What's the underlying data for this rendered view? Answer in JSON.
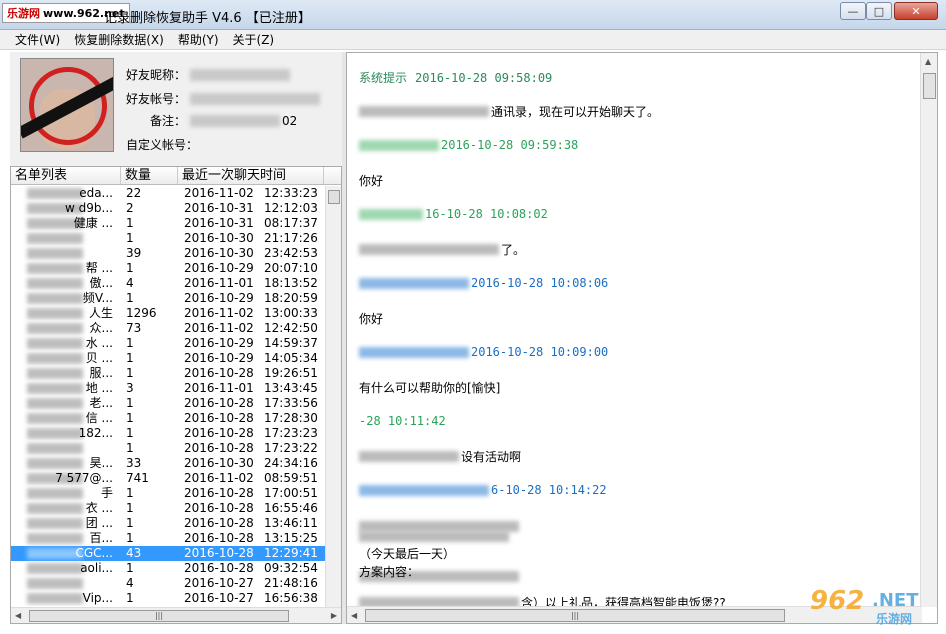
{
  "window": {
    "site_logo": "乐游网",
    "site_url": "www.962.net",
    "title": "记录删除恢复助手  V4.6 【已注册】",
    "minimize": "—",
    "maximize": "□",
    "close": "✕"
  },
  "menu": [
    {
      "label": "文件(W)"
    },
    {
      "label": "恢复删除数据(X)"
    },
    {
      "label": "帮助(Y)"
    },
    {
      "label": "关于(Z)"
    }
  ],
  "profile": {
    "nickname_label": "好友昵称：",
    "account_label": "好友帐号：",
    "remark_label": "备注：",
    "remark_value": "02",
    "custom_label": "自定义帐号："
  },
  "list": {
    "headers": {
      "name": "名单列表",
      "count": "数量",
      "last_time": "最近一次聊天时间"
    },
    "rows": [
      {
        "name": "eda...",
        "count": "22",
        "date": "2016-11-02",
        "time": "12:33:23"
      },
      {
        "name": "w d9b...",
        "count": "2",
        "date": "2016-10-31",
        "time": "12:12:03"
      },
      {
        "name": "健康 ...",
        "count": "1",
        "date": "2016-10-31",
        "time": "08:17:37"
      },
      {
        "name": "",
        "count": "1",
        "date": "2016-10-30",
        "time": "21:17:26"
      },
      {
        "name": "",
        "count": "39",
        "date": "2016-10-30",
        "time": "23:42:53"
      },
      {
        "name": "帮 ...",
        "count": "1",
        "date": "2016-10-29",
        "time": "20:07:10"
      },
      {
        "name": "傲...",
        "count": "4",
        "date": "2016-11-01",
        "time": "18:13:52"
      },
      {
        "name": "频V...",
        "count": "1",
        "date": "2016-10-29",
        "time": "18:20:59"
      },
      {
        "name": "人生",
        "count": "1296",
        "date": "2016-11-02",
        "time": "13:00:33"
      },
      {
        "name": "众...",
        "count": "73",
        "date": "2016-11-02",
        "time": "12:42:50"
      },
      {
        "name": "水 ...",
        "count": "1",
        "date": "2016-10-29",
        "time": "14:59:37"
      },
      {
        "name": "贝 ...",
        "count": "1",
        "date": "2016-10-29",
        "time": "14:05:34"
      },
      {
        "name": "服...",
        "count": "1",
        "date": "2016-10-28",
        "time": "19:26:51"
      },
      {
        "name": "地 ...",
        "count": "3",
        "date": "2016-11-01",
        "time": "13:43:45"
      },
      {
        "name": "老...",
        "count": "1",
        "date": "2016-10-28",
        "time": "17:33:56"
      },
      {
        "name": "信 ...",
        "count": "1",
        "date": "2016-10-28",
        "time": "17:28:30"
      },
      {
        "name": "182...",
        "count": "1",
        "date": "2016-10-28",
        "time": "17:23:23"
      },
      {
        "name": "",
        "count": "1",
        "date": "2016-10-28",
        "time": "17:23:22"
      },
      {
        "name": "昊...",
        "count": "33",
        "date": "2016-10-30",
        "time": "24:34:16"
      },
      {
        "name": "7 577@...",
        "count": "741",
        "date": "2016-11-02",
        "time": "08:59:51"
      },
      {
        "name": "手",
        "count": "1",
        "date": "2016-10-28",
        "time": "17:00:51"
      },
      {
        "name": "衣 ...",
        "count": "1",
        "date": "2016-10-28",
        "time": "16:55:46"
      },
      {
        "name": "团 ...",
        "count": "1",
        "date": "2016-10-28",
        "time": "13:46:11"
      },
      {
        "name": "百...",
        "count": "1",
        "date": "2016-10-28",
        "time": "13:15:25"
      },
      {
        "name": "CGC...",
        "count": "43",
        "date": "2016-10-28",
        "time": "12:29:41",
        "selected": true
      },
      {
        "name": "aoli...",
        "count": "1",
        "date": "2016-10-28",
        "time": "09:32:54"
      },
      {
        "name": "",
        "count": "4",
        "date": "2016-10-27",
        "time": "21:48:16"
      },
      {
        "name": "Vip...",
        "count": "1",
        "date": "2016-10-27",
        "time": "16:56:38"
      }
    ]
  },
  "chat": {
    "messages": [
      {
        "sender": "系统提示",
        "timestamp": "2016-10-28 09:58:09",
        "color": "system",
        "body": "通讯录，现在可以开始聊天了。"
      },
      {
        "sender": "",
        "timestamp": "2016-10-28 09:59:38",
        "color": "green",
        "body": "你好"
      },
      {
        "sender": "",
        "timestamp": "16-10-28 10:08:02",
        "color": "green",
        "body": "了。"
      },
      {
        "sender": "",
        "timestamp": "2016-10-28 10:08:06",
        "color": "blue",
        "body": "你好"
      },
      {
        "sender": "",
        "timestamp": "2016-10-28 10:09:00",
        "color": "blue",
        "body": "有什么可以帮助你的[愉快]"
      },
      {
        "sender": "",
        "timestamp": "-28 10:11:42",
        "color": "green",
        "body": "设有活动啊"
      },
      {
        "sender": "",
        "timestamp": "6-10-28 10:14:22",
        "color": "blue",
        "body": ""
      }
    ],
    "tail_lines": [
      "（今天最后一天）",
      "方案内容：",
      "含）以上礼品，获得高档智能电饭煲??"
    ]
  },
  "watermark": {
    "num": "962",
    "net": ".NET",
    "sub": "乐游网"
  },
  "colors": {
    "system": "#2a8a5a",
    "green": "#2aa35a",
    "blue": "#1a6fc4",
    "selection": "#3399ff"
  }
}
